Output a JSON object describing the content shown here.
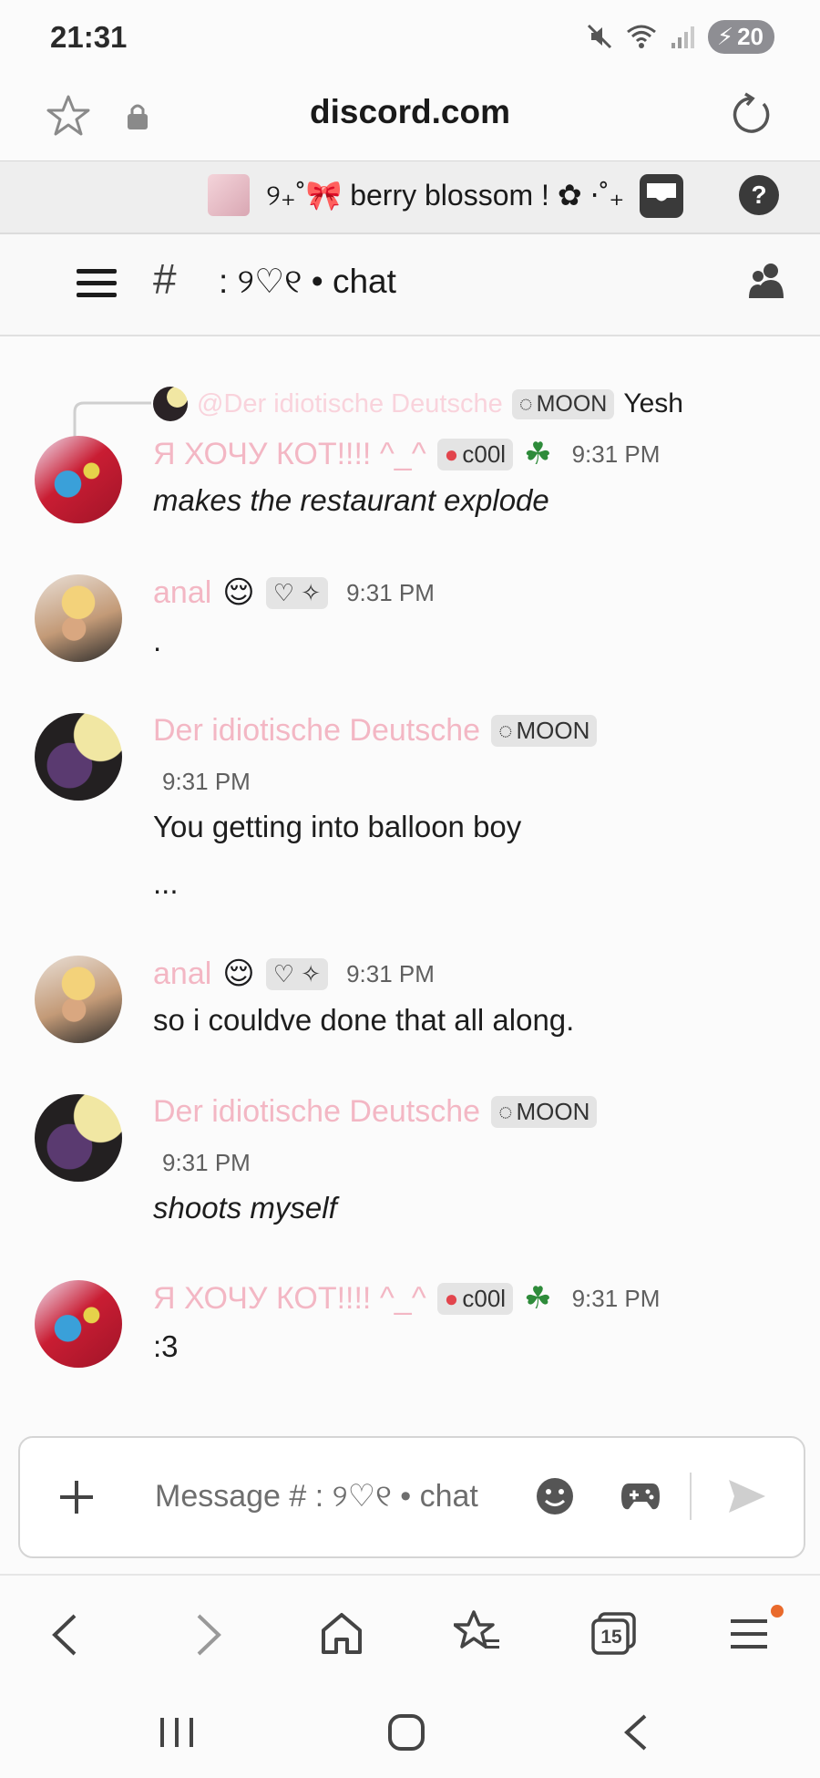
{
  "status_bar": {
    "time": "21:31",
    "battery": "20"
  },
  "browser": {
    "domain": "discord.com"
  },
  "server": {
    "name": "୨₊˚🎀 berry blossom ! ✿ ⋅˚₊"
  },
  "channel": {
    "name": ": ୨♡୧ • chat"
  },
  "reply_preview": {
    "author": "@Der idiotische Deutsche",
    "tag": "MOON",
    "text": "Yesh"
  },
  "messages": [
    {
      "author": "Я ХОЧУ КОТ!!!! ^_^",
      "tag": "c00l",
      "time": "9:31 PM",
      "text": "makes the restaurant explode",
      "italic": true
    },
    {
      "author": "anal",
      "time": "9:31 PM",
      "text": "."
    },
    {
      "author": "Der idiotische Deutsche",
      "tag": "MOON",
      "time": "9:31 PM",
      "text": "You getting into balloon boy",
      "text2": "..."
    },
    {
      "author": "anal",
      "time": "9:31 PM",
      "text": "so i couldve done that all along."
    },
    {
      "author": "Der idiotische Deutsche",
      "tag": "MOON",
      "time": "9:31 PM",
      "text": "shoots myself",
      "italic": true
    },
    {
      "author": "Я ХОЧУ КОТ!!!! ^_^",
      "tag": "c00l",
      "time": "9:31 PM",
      "text": ":3"
    }
  ],
  "composer": {
    "placeholder": "Message # : ୨♡୧ • chat"
  },
  "browser_nav": {
    "tabs_count": "15"
  },
  "icons": {
    "star": "star-icon",
    "lock": "lock-icon",
    "reload": "reload-icon",
    "inbox": "inbox-icon",
    "help": "help-icon",
    "menu": "hamburger-icon",
    "hash": "hash-icon",
    "members": "members-icon",
    "plus": "plus-icon",
    "emoji": "emoji-icon",
    "gamepad": "gamepad-icon",
    "send": "send-icon"
  },
  "colors": {
    "username": "#f3b7c4",
    "accent": "#e96a2c"
  }
}
